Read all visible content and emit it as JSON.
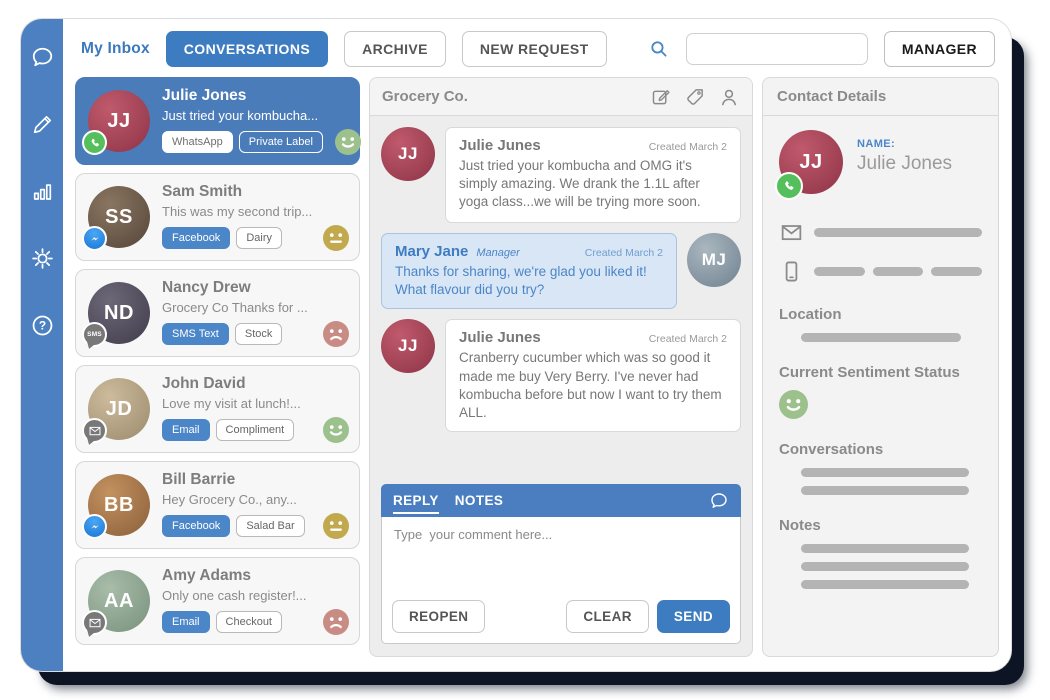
{
  "colors": {
    "primary_blue": "#4a7ec1",
    "badge_blue": "#4a86c8",
    "sidebar_blue": "#4d80c1",
    "selected_item_blue": "#4a7cba",
    "agent_bubble": "#d9e6f6",
    "happy_green": "#9cc18c",
    "neutral_olive": "#c2a94e",
    "sad_red": "#c98c84",
    "whatsapp_green": "#55c05b",
    "shadow_navy": "#0d1424"
  },
  "rail": {
    "icons": [
      "chat-icon",
      "compose-icon",
      "analytics-icon",
      "settings-icon",
      "help-icon"
    ]
  },
  "topbar": {
    "inbox_label": "My Inbox",
    "conversations_tab": "CONVERSATIONS",
    "archive_tab": "ARCHIVE",
    "new_request_tab": "NEW REQUEST",
    "search_value": "",
    "role_button": "MANAGER"
  },
  "channels": {
    "sms_label": "SMS"
  },
  "conversation_list": {
    "items": [
      {
        "name": "Julie Jones",
        "preview": "Just tried your kombucha...",
        "channel": "whatsapp",
        "channel_label": "WhatsApp",
        "tag": "Private Label",
        "sentiment": "happy",
        "selected": true,
        "initials": "JJ"
      },
      {
        "name": "Sam Smith",
        "preview": "This was my second trip...",
        "channel": "messenger",
        "channel_label": "Facebook",
        "tag": "Dairy",
        "sentiment": "neutral",
        "selected": false,
        "initials": "SS"
      },
      {
        "name": "Nancy Drew",
        "preview": "Grocery Co Thanks for ...",
        "channel": "sms",
        "channel_label": "SMS Text",
        "tag": "Stock",
        "sentiment": "sad",
        "selected": false,
        "initials": "ND"
      },
      {
        "name": "John David",
        "preview": "Love my visit at lunch!...",
        "channel": "email",
        "channel_label": "Email",
        "tag": "Compliment",
        "sentiment": "happy",
        "selected": false,
        "initials": "JD"
      },
      {
        "name": "Bill Barrie",
        "preview": "Hey Grocery Co., any...",
        "channel": "messenger",
        "channel_label": "Facebook",
        "tag": "Salad Bar",
        "sentiment": "neutral",
        "selected": false,
        "initials": "BB"
      },
      {
        "name": "Amy Adams",
        "preview": "Only one cash register!...",
        "channel": "email",
        "channel_label": "Email",
        "tag": "Checkout",
        "sentiment": "sad",
        "selected": false,
        "initials": "AA"
      }
    ]
  },
  "thread": {
    "title": "Grocery Co.",
    "messages": [
      {
        "author": "Julie Junes",
        "meta": "Created March 2",
        "text": "Just tried your kombucha and OMG it's simply amazing. We drank the 1.1L after yoga class...we will be trying more soon.",
        "initials": "JJ"
      },
      {
        "author": "Mary Jane",
        "role": "Manager",
        "meta": "Created March 2",
        "text": "Thanks for sharing, we're glad you liked it! What flavour did you try?",
        "initials": "MJ"
      },
      {
        "author": "Julie Junes",
        "meta": "Created March 2",
        "text": "Cranberry cucumber which was so good it made me buy Very Berry. I've never had kombucha before but now I want to try them ALL.",
        "initials": "JJ"
      }
    ],
    "reply": {
      "tabs": [
        "REPLY",
        "NOTES"
      ],
      "placeholder": "Type  your comment here...",
      "reopen_label": "REOPEN",
      "clear_label": "CLEAR",
      "send_label": "SEND"
    }
  },
  "contact": {
    "title": "Contact Details",
    "name_label": "NAME:",
    "name": "Julie Jones",
    "initials": "JJ",
    "channel": "whatsapp",
    "location_label": "Location",
    "sentiment_label": "Current Sentiment Status",
    "sentiment": "happy",
    "conversations_label": "Conversations",
    "notes_label": "Notes"
  }
}
